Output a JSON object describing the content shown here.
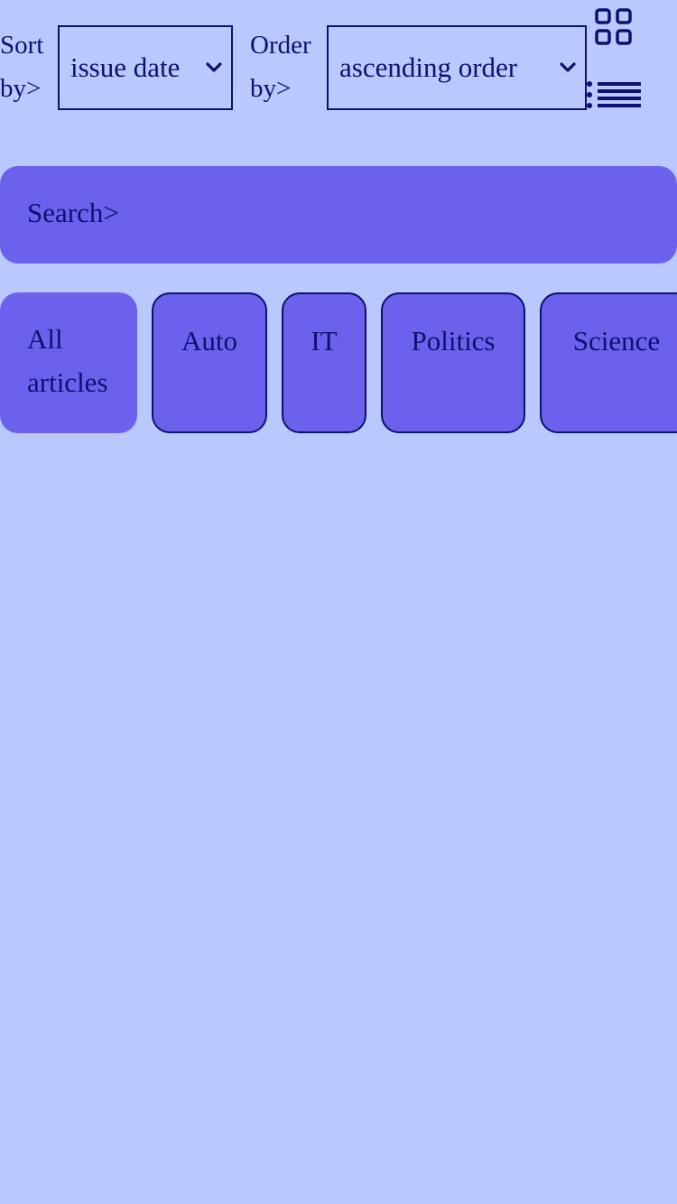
{
  "toolbar": {
    "sort_label_line1": "Sort",
    "sort_label_line2": "by>",
    "sort_value": "issue date",
    "order_label_line1": "Order",
    "order_label_line2": "by>",
    "order_value": "ascending order",
    "grid_view_icon": "grid-icon",
    "list_view_icon": "list-icon"
  },
  "search": {
    "placeholder": "Search>"
  },
  "categories": [
    {
      "label_line1": "All",
      "label_line2": "articles",
      "active": true
    },
    {
      "label": "Auto"
    },
    {
      "label": "IT"
    },
    {
      "label": "Politics"
    },
    {
      "label": "Science"
    }
  ],
  "colors": {
    "background": "#b9c8fd",
    "accent": "#6c61ed",
    "text": "#0b1270"
  }
}
